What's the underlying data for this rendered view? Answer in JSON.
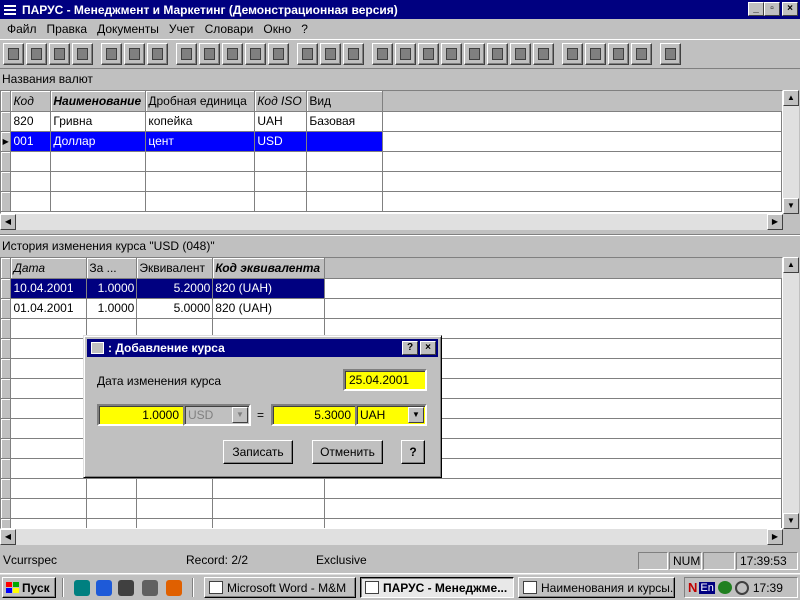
{
  "window": {
    "title": "ПАРУС - Менеджмент и Маркетинг (Демонстрационная версия)",
    "controls": [
      "_",
      "▫",
      "×"
    ]
  },
  "menu": [
    "Файл",
    "Правка",
    "Документы",
    "Учет",
    "Словари",
    "Окно",
    "?"
  ],
  "toolbar_icons": [
    "new-icon",
    "copy-icon",
    "edit-icon",
    "delete-icon",
    "insert-icon",
    "add-icon",
    "append-icon",
    "filter-icon",
    "undo-icon",
    "print-icon",
    "print-setup-icon",
    "doc1-icon",
    "doc2-icon",
    "doc3-icon",
    "globe-icon",
    "refresh-icon",
    "clock-icon",
    "tools-icon",
    "gear-icon",
    "book-icon",
    "currency-icon",
    "settings-icon",
    "person-icon",
    "wrench-icon",
    "calculator-icon",
    "help-icon",
    "window-icon",
    "exit-icon"
  ],
  "currencies": {
    "label": "Названия валют",
    "columns": [
      "Код",
      "Наименование",
      "Дробная единица",
      "Код ISO",
      "Вид"
    ],
    "rows": [
      [
        "820",
        "Гривна",
        "копейка",
        "UAH",
        "Базовая"
      ],
      [
        "001",
        "Доллар",
        "цент",
        "USD",
        ""
      ]
    ]
  },
  "history": {
    "label": "История изменения курса  \"USD (048)\"",
    "columns": [
      "Дата",
      "За ...",
      "Эквивалент",
      "Код эквивалента"
    ],
    "rows": [
      [
        "10.04.2001",
        "1.0000",
        "5.2000",
        "820  (UAH)"
      ],
      [
        "01.04.2001",
        "1.0000",
        "5.0000",
        "820  (UAH)"
      ]
    ]
  },
  "dialog": {
    "title": ": Добавление курса",
    "date_label": "Дата изменения курса",
    "date_value": "25.04.2001",
    "amount_value": "1.0000",
    "from_currency": "USD",
    "equals": "=",
    "rate_value": "5.3000",
    "to_currency": "UAH",
    "save_label": "Записать",
    "cancel_label": "Отменить",
    "help_label": "?",
    "title_help": "?",
    "title_close": "×"
  },
  "status": {
    "module": "Vcurrspec",
    "record": "Record: 2/2",
    "mode": "Exclusive",
    "num": "NUM",
    "time": "17:39:53"
  },
  "taskbar": {
    "start_label": "Пуск",
    "items": [
      "Microsoft Word - M&M",
      "ПАРУС - Менеджме...",
      "Наименования и курсы..."
    ],
    "lang": "En",
    "clock": "17:39"
  }
}
